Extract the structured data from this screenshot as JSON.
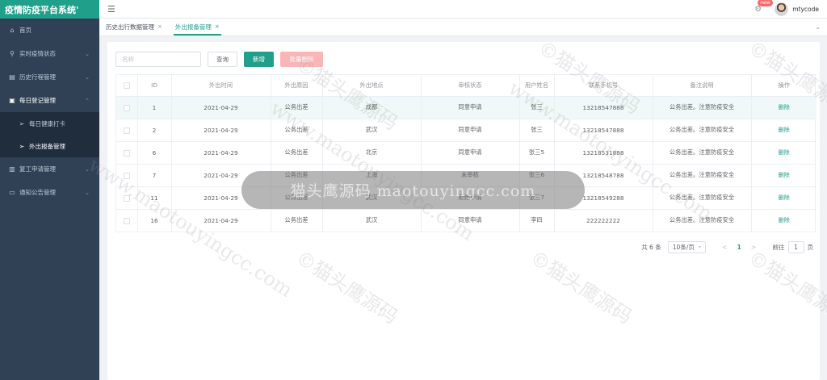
{
  "app": {
    "title": "疫情防疫平台系统'"
  },
  "sidebar": {
    "items": [
      {
        "label": "首页",
        "icon": "home-icon"
      },
      {
        "label": "实时疫情状态",
        "icon": "location-icon"
      },
      {
        "label": "历史行程管理",
        "icon": "calendar-icon"
      },
      {
        "label": "每日登记管理",
        "icon": "register-icon",
        "children": [
          {
            "label": "每日健康打卡",
            "icon": "send-icon"
          },
          {
            "label": "外出报备管理",
            "icon": "send-icon"
          }
        ]
      },
      {
        "label": "复工申请管理",
        "icon": "briefcase-icon"
      },
      {
        "label": "通知公告管理",
        "icon": "message-icon"
      }
    ]
  },
  "header": {
    "badge": "new",
    "username": "mtycode"
  },
  "tabs": [
    {
      "label": "历史出行数据管理",
      "close": "×"
    },
    {
      "label": "外出报备管理",
      "close": "×"
    }
  ],
  "toolbar": {
    "search_placeholder": "名称",
    "query_label": "查询",
    "add_label": "新增",
    "batch_delete_label": "批量删除"
  },
  "table": {
    "headers": [
      "ID",
      "外出时间",
      "外出原因",
      "外出地点",
      "审核状态",
      "用户姓名",
      "联系手机号",
      "备注说明",
      "操作"
    ],
    "rows": [
      {
        "id": "1",
        "time": "2021-04-29",
        "reason": "公务出差",
        "place": "成都",
        "status": "同意申请",
        "name": "张三",
        "phone": "13218547888",
        "note": "公务出差。注意防疫安全",
        "action": "删除"
      },
      {
        "id": "2",
        "time": "2021-04-29",
        "reason": "公务出差",
        "place": "武汉",
        "status": "同意申请",
        "name": "张三",
        "phone": "13218547888",
        "note": "公务出差。注意防疫安全",
        "action": "删除"
      },
      {
        "id": "6",
        "time": "2021-04-29",
        "reason": "公务出差",
        "place": "北京",
        "status": "同意申请",
        "name": "张三5",
        "phone": "13218531888",
        "note": "公务出差。注意防疫安全",
        "action": "删除"
      },
      {
        "id": "7",
        "time": "2021-04-29",
        "reason": "公务出差",
        "place": "上海",
        "status": "未审核",
        "name": "张三6",
        "phone": "13218548788",
        "note": "公务出差。注意防疫安全",
        "action": "删除"
      },
      {
        "id": "11",
        "time": "2021-04-29",
        "reason": "公务出差",
        "place": "武汉",
        "status": "拒绝申请",
        "name": "张三7",
        "phone": "13218549288",
        "note": "公务出差。注意防疫安全",
        "action": "删除"
      },
      {
        "id": "16",
        "time": "2021-04-29",
        "reason": "公务出差",
        "place": "武汉",
        "status": "同意申请",
        "name": "李四",
        "phone": "222222222",
        "note": "公务出差。注意防疫安全",
        "action": "删除"
      }
    ]
  },
  "pagination": {
    "total": "共 6 条",
    "page_size": "10条/页",
    "prev": "<",
    "current": "1",
    "next": ">",
    "goto_label": "前往",
    "goto_value": "1",
    "goto_suffix": "页"
  },
  "watermark": {
    "center": "猫头鹰源码 maotouyingcc.com",
    "diag_cn": "©猫头鹰源码",
    "diag_en": "www.maotouyingcc.com"
  },
  "colors": {
    "accent": "#20a08a",
    "sidebar_bg": "#304156",
    "danger_light": "#fab6b6"
  }
}
